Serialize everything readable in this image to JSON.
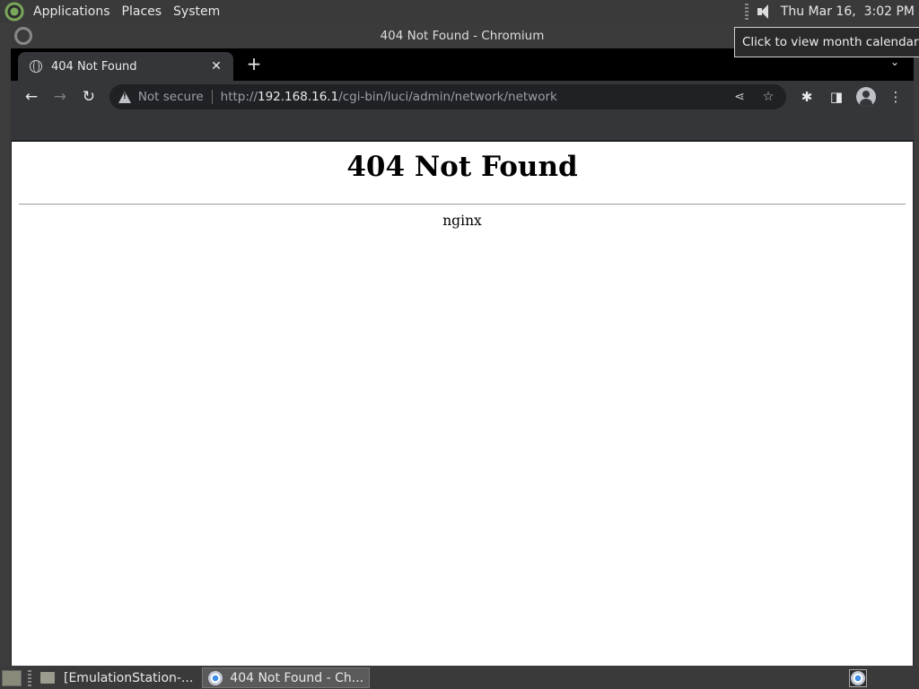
{
  "top_panel": {
    "menus": [
      "Applications",
      "Places",
      "System"
    ],
    "clock": "Thu Mar 16,  3:02 PM"
  },
  "tooltip": "Click to view month calendar",
  "window": {
    "title": "404 Not Found - Chromium"
  },
  "tabs": [
    {
      "title": "404 Not Found"
    }
  ],
  "omnibox": {
    "security_label": "Not secure",
    "url_scheme": "http://",
    "url_host": "192.168.16.1",
    "url_path": "/cgi-bin/luci/admin/network/network"
  },
  "page": {
    "heading": "404 Not Found",
    "server": "nginx"
  },
  "taskbar": {
    "tasks": [
      {
        "label": "[EmulationStation-...",
        "icon": "folder-icon"
      },
      {
        "label": "404 Not Found - Ch...",
        "icon": "chromium-icon"
      }
    ]
  },
  "colors": {
    "panel_bg": "#3a3a3a",
    "toolbar_bg": "#35363a",
    "omnibox_bg": "#202124",
    "page_bg": "#ffffff"
  }
}
